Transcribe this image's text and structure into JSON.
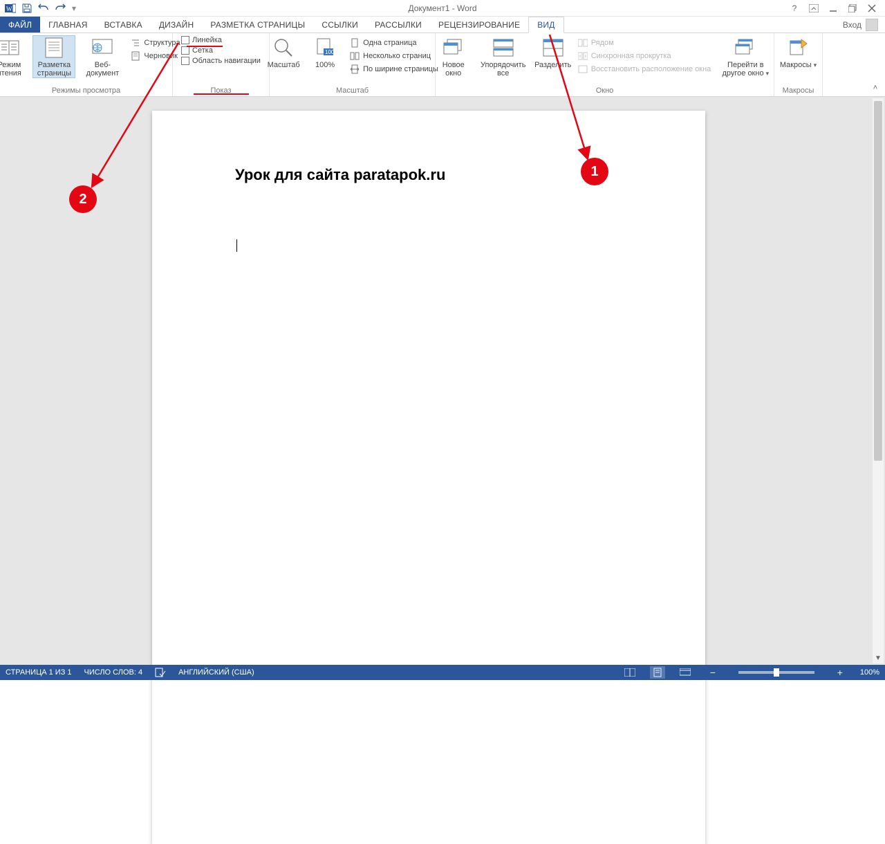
{
  "app": {
    "title": "Документ1 - Word",
    "login_label": "Вход"
  },
  "qat": {
    "icons": [
      "word",
      "save",
      "undo",
      "redo"
    ]
  },
  "tabs": {
    "file": "ФАЙЛ",
    "items": [
      "ГЛАВНАЯ",
      "ВСТАВКА",
      "ДИЗАЙН",
      "РАЗМЕТКА СТРАНИЦЫ",
      "ССЫЛКИ",
      "РАССЫЛКИ",
      "РЕЦЕНЗИРОВАНИЕ",
      "ВИД"
    ],
    "active": "ВИД"
  },
  "ribbon": {
    "views_group": {
      "label": "Режимы просмотра",
      "read_mode": "Режим чтения",
      "page_layout": "Разметка страницы",
      "web_layout": "Веб-документ",
      "outline": "Структура",
      "draft": "Черновик"
    },
    "show_group": {
      "label": "Показ",
      "ruler": "Линейка",
      "grid": "Сетка",
      "nav": "Область навигации"
    },
    "zoom_group": {
      "label": "Масштаб",
      "zoom": "Масштаб",
      "p100": "100%",
      "one_page": "Одна страница",
      "multi_page": "Несколько страниц",
      "page_width": "По ширине страницы"
    },
    "window_group": {
      "label": "Окно",
      "new_window": "Новое окно",
      "arrange_all": "Упорядочить все",
      "split": "Разделить",
      "side_by_side": "Рядом",
      "sync_scroll": "Синхронная прокрутка",
      "reset_pos": "Восстановить расположение окна",
      "switch_window": "Перейти в другое окно"
    },
    "macros_group": {
      "label": "Макросы",
      "macros": "Макросы"
    }
  },
  "document": {
    "heading": "Урок для сайта paratapok.ru"
  },
  "callouts": {
    "one": "1",
    "two": "2"
  },
  "status": {
    "page": "СТРАНИЦА 1 ИЗ 1",
    "words": "ЧИСЛО СЛОВ: 4",
    "lang": "АНГЛИЙСКИЙ (США)",
    "zoom": "100%"
  }
}
